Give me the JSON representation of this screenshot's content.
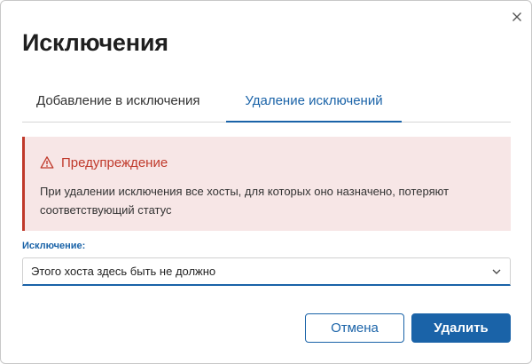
{
  "dialog": {
    "title": "Исключения",
    "close_icon": "close-icon"
  },
  "tabs": [
    {
      "label": "Добавление в исключения",
      "active": false
    },
    {
      "label": "Удаление исключений",
      "active": true
    }
  ],
  "warning": {
    "icon": "warning-triangle-icon",
    "title": "Предупреждение",
    "text": "При удалении исключения все хосты, для которых оно назначено, потеряют соответствующий статус"
  },
  "exclusion_field": {
    "label": "Исключение:",
    "value": "Этого хоста здесь быть не должно",
    "icon": "chevron-down-icon"
  },
  "buttons": {
    "cancel_label": "Отмена",
    "delete_label": "Удалить"
  },
  "colors": {
    "accent": "#1a63a8",
    "warning_text": "#c0392b",
    "warning_background": "#f7e6e6"
  }
}
